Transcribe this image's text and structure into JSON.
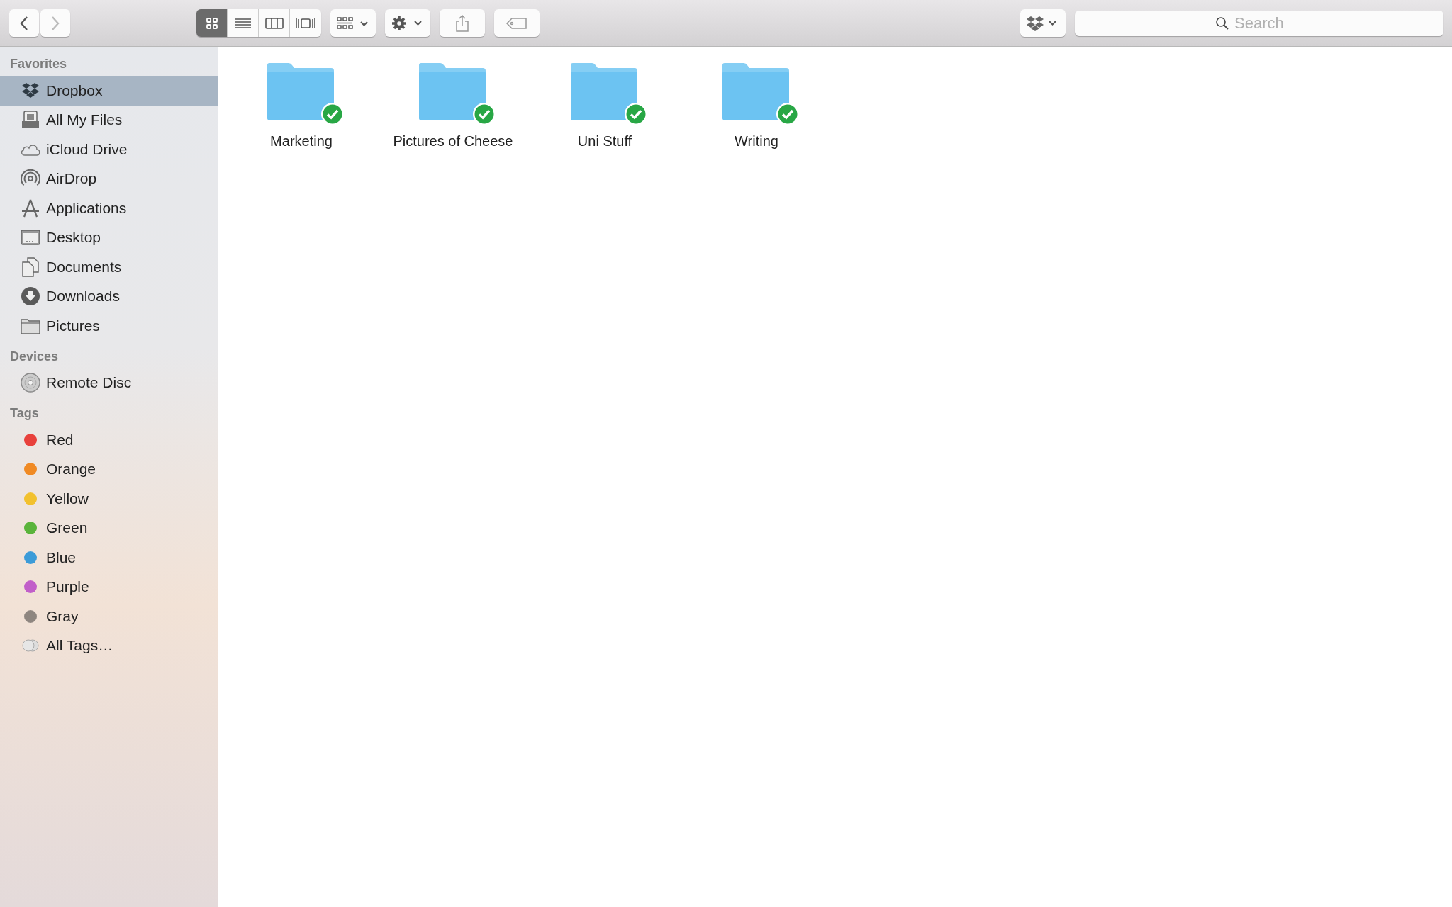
{
  "toolbar": {
    "view_buttons": [
      {
        "kind": "icon",
        "selected": true
      },
      {
        "kind": "list",
        "selected": false
      },
      {
        "kind": "columns",
        "selected": false
      },
      {
        "kind": "coverflow",
        "selected": false
      }
    ],
    "search": {
      "placeholder": "Search"
    }
  },
  "sidebar": {
    "sections": [
      {
        "title": "Favorites",
        "items": [
          {
            "kind": "dropbox",
            "label": "Dropbox",
            "selected": true
          },
          {
            "kind": "allfiles",
            "label": "All My Files",
            "selected": false
          },
          {
            "kind": "cloud",
            "label": "iCloud Drive",
            "selected": false
          },
          {
            "kind": "airdrop",
            "label": "AirDrop",
            "selected": false
          },
          {
            "kind": "apps",
            "label": "Applications",
            "selected": false
          },
          {
            "kind": "desktop",
            "label": "Desktop",
            "selected": false
          },
          {
            "kind": "documents",
            "label": "Documents",
            "selected": false
          },
          {
            "kind": "downloads",
            "label": "Downloads",
            "selected": false
          },
          {
            "kind": "folder",
            "label": "Pictures",
            "selected": false
          }
        ]
      },
      {
        "title": "Devices",
        "items": [
          {
            "kind": "disc",
            "label": "Remote Disc",
            "selected": false
          }
        ]
      },
      {
        "title": "Tags",
        "items": [
          {
            "kind": "tag",
            "label": "Red",
            "color": "#e8413c",
            "selected": false
          },
          {
            "kind": "tag",
            "label": "Orange",
            "color": "#f08a24",
            "selected": false
          },
          {
            "kind": "tag",
            "label": "Yellow",
            "color": "#f2c12e",
            "selected": false
          },
          {
            "kind": "tag",
            "label": "Green",
            "color": "#5ab43b",
            "selected": false
          },
          {
            "kind": "tag",
            "label": "Blue",
            "color": "#3b9bd8",
            "selected": false
          },
          {
            "kind": "tag",
            "label": "Purple",
            "color": "#c15fc9",
            "selected": false
          },
          {
            "kind": "tag",
            "label": "Gray",
            "color": "#8e8680",
            "selected": false
          },
          {
            "kind": "alltags",
            "label": "All Tags…",
            "selected": false
          }
        ]
      }
    ]
  },
  "files": [
    {
      "name": "Marketing",
      "synced": true
    },
    {
      "name": "Pictures of Cheese",
      "synced": true
    },
    {
      "name": "Uni Stuff",
      "synced": true
    },
    {
      "name": "Writing",
      "synced": true
    }
  ]
}
